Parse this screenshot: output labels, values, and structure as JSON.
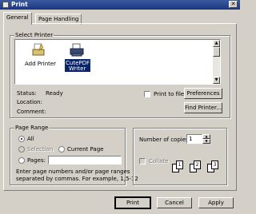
{
  "window": {
    "title": "Print"
  },
  "tabs": [
    "General",
    "Page Handling"
  ],
  "select_printer": {
    "label": "Select Printer",
    "printers": [
      "Add Printer",
      "CutePDF Writer"
    ],
    "status_label": "Status:",
    "status_value": "Ready",
    "location_label": "Location:",
    "comment_label": "Comment:",
    "print_to_file": "Print to file",
    "preferences": "Preferences",
    "find_printer": "Find Printer..."
  },
  "page_range": {
    "label": "Page Range",
    "all": "All",
    "selection": "Selection",
    "current_page": "Current Page",
    "pages": "Pages:",
    "hint_line1": "Enter page numbers and/or page ranges",
    "hint_line2": "separated by commas.  For example, 1,5-12"
  },
  "copies": {
    "label": "Number of copies:",
    "value": "1",
    "collate": "Collate",
    "pages": [
      "1",
      "1",
      "2",
      "2",
      "3",
      "3"
    ]
  },
  "buttons": {
    "print": "Print",
    "cancel": "Cancel",
    "apply": "Apply"
  }
}
